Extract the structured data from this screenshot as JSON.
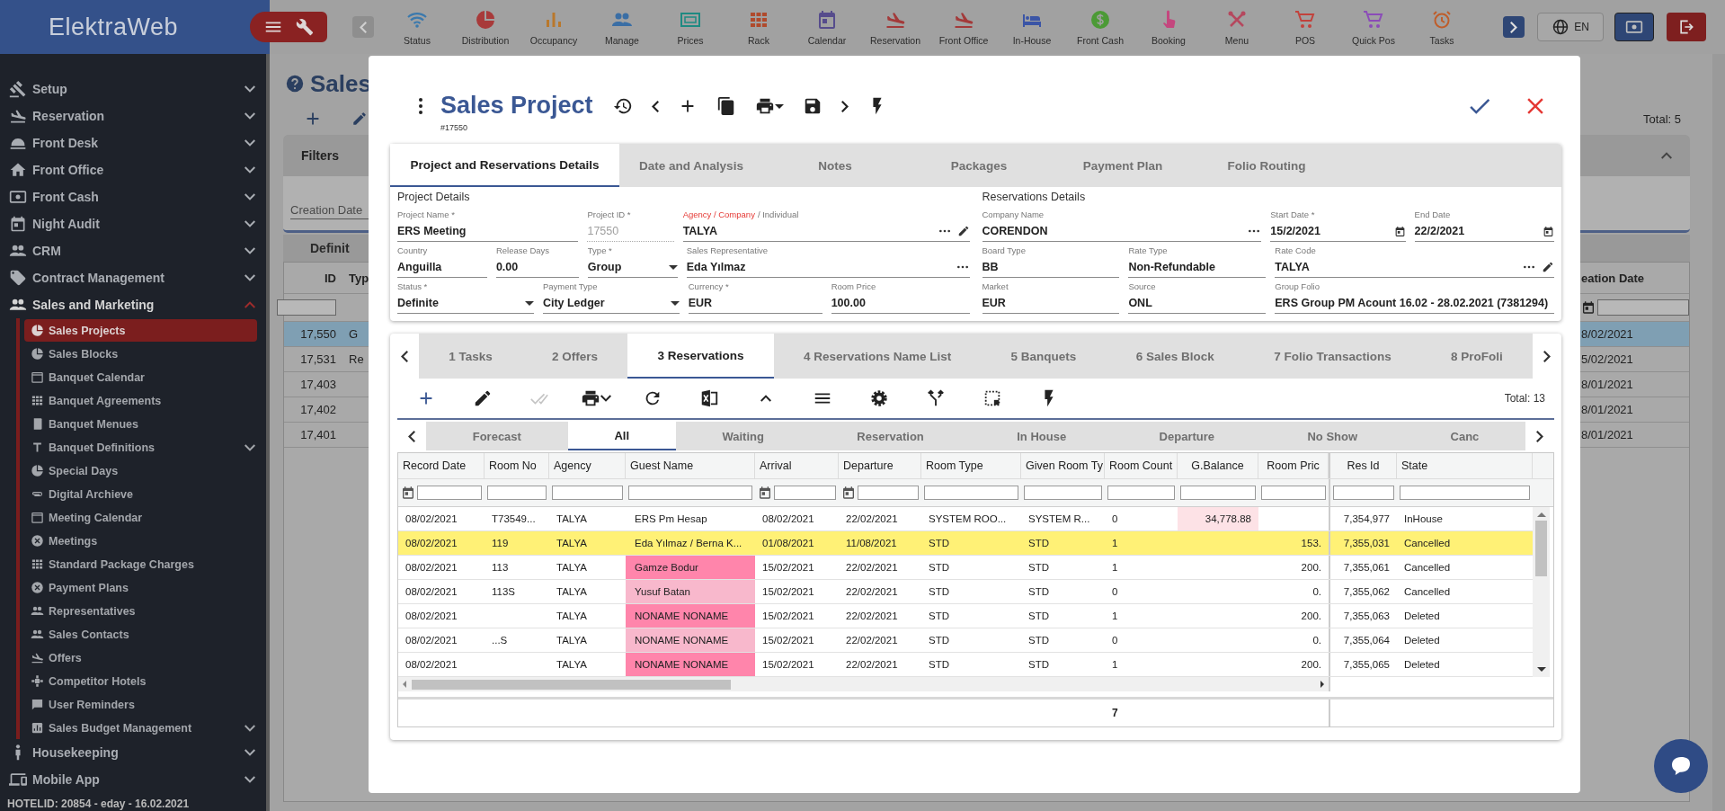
{
  "app": {
    "logo": "ElektraWeb"
  },
  "nav": {
    "items": [
      {
        "label": "Status",
        "color": "#3b79ad"
      },
      {
        "label": "Distribution",
        "color": "#a83a3a"
      },
      {
        "label": "Occupancy",
        "color": "#b9782c"
      },
      {
        "label": "Manage",
        "color": "#3a6ea5"
      },
      {
        "label": "Prices",
        "color": "#1e8a82"
      },
      {
        "label": "Rack",
        "color": "#b04a2c"
      },
      {
        "label": "Calendar",
        "color": "#564c8c"
      },
      {
        "label": "Reservation",
        "color": "#a33a3a"
      },
      {
        "label": "Front Office",
        "color": "#a33a3a"
      },
      {
        "label": "In-House",
        "color": "#3b55a6"
      },
      {
        "label": "Front Cash",
        "color": "#4c9a36"
      },
      {
        "label": "Booking",
        "color": "#c4477e"
      },
      {
        "label": "Menu",
        "color": "#b5485e"
      },
      {
        "label": "POS",
        "color": "#c2423c"
      },
      {
        "label": "Quick Pos",
        "color": "#8b4cb8"
      },
      {
        "label": "Tasks",
        "color": "#bf5d2a"
      }
    ]
  },
  "language": {
    "label": "EN"
  },
  "sidebar": {
    "items": [
      {
        "label": "Setup",
        "expanded": false
      },
      {
        "label": "Reservation",
        "expanded": false
      },
      {
        "label": "Front Desk",
        "expanded": false
      },
      {
        "label": "Front Office",
        "expanded": false
      },
      {
        "label": "Front Cash",
        "expanded": false
      },
      {
        "label": "Night Audit",
        "expanded": false
      },
      {
        "label": "CRM",
        "expanded": false
      },
      {
        "label": "Contract Management",
        "expanded": false
      },
      {
        "label": "Sales and Marketing",
        "expanded": true,
        "children": [
          {
            "label": "Sales Projects",
            "selected": true
          },
          {
            "label": "Sales Blocks",
            "selected": false
          },
          {
            "label": "Banquet Calendar",
            "selected": false
          },
          {
            "label": "Banquet Agreements",
            "selected": false
          },
          {
            "label": "Banquet Menues",
            "selected": false
          },
          {
            "label": "Banquet Definitions",
            "selected": false,
            "expanded": false
          },
          {
            "label": "Special Days",
            "selected": false
          },
          {
            "label": "Digital Archieve",
            "selected": false
          },
          {
            "label": "Meeting Calendar",
            "selected": false
          },
          {
            "label": "Meetings",
            "selected": false
          },
          {
            "label": "Standard Package Charges",
            "selected": false
          },
          {
            "label": "Payment Plans",
            "selected": false
          },
          {
            "label": "Representatives",
            "selected": false
          },
          {
            "label": "Sales Contacts",
            "selected": false
          },
          {
            "label": "Offers",
            "selected": false
          },
          {
            "label": "Competitor Hotels",
            "selected": false
          },
          {
            "label": "User Reminders",
            "selected": false
          },
          {
            "label": "Sales Budget Management",
            "selected": false,
            "expanded": false
          }
        ]
      },
      {
        "label": "Housekeeping",
        "expanded": false
      },
      {
        "label": "Mobile App",
        "expanded": false
      }
    ],
    "footer": "HOTELID: 20854 - eday - 16.02.2021"
  },
  "page": {
    "title": "Sales",
    "total": "Total: 5",
    "filters": {
      "title": "Filters",
      "expanded": true,
      "placeholder": "Creation Date"
    },
    "tab": "Definit",
    "grid": {
      "columns": [
        "ID",
        "Typ",
        "eation Date"
      ],
      "rows": [
        {
          "id": "17,550",
          "type": "G",
          "created": "8/02/2021",
          "selected": true
        },
        {
          "id": "17,531",
          "type": "Re",
          "created": "5/02/2021",
          "selected": false
        },
        {
          "id": "17,403",
          "created": "8/01/2021",
          "selected": false
        },
        {
          "id": "17,402",
          "created": "8/01/2021",
          "selected": false
        },
        {
          "id": "17,401",
          "created": "8/01/2021",
          "selected": false
        }
      ]
    }
  },
  "dialog": {
    "title": "Sales Project",
    "subtitle": "#17550",
    "tabs": [
      {
        "label": "Project and Reservations Details",
        "selected": true
      },
      {
        "label": "Date and Analysis",
        "selected": false
      },
      {
        "label": "Notes",
        "selected": false
      },
      {
        "label": "Packages",
        "selected": false
      },
      {
        "label": "Payment Plan",
        "selected": false
      },
      {
        "label": "Folio Routing",
        "selected": false
      }
    ],
    "sections": [
      {
        "title": "Project Details",
        "fields": [
          {
            "label": "Project Name *",
            "value": "ERS Meeting",
            "kind": "text"
          },
          {
            "label": "Project ID *",
            "value": "17550",
            "kind": "disabled"
          },
          {
            "label_parts": [
              {
                "text": "Agency / Company",
                "selected": true
              },
              {
                "text": "/ Individual",
                "selected": false
              }
            ],
            "value": "TALYA",
            "kind": "lookup_edit"
          },
          {
            "label": "Country",
            "value": "Anguilla",
            "kind": "text"
          },
          {
            "label": "Release Days",
            "value": "0.00",
            "kind": "text"
          },
          {
            "label": "Type *",
            "value": "Group",
            "kind": "select"
          },
          {
            "label": "Sales Representative",
            "value": "Eda Yılmaz",
            "kind": "lookup"
          },
          {
            "label": "Status *",
            "value": "Definite",
            "kind": "select"
          },
          {
            "label": "Payment Type",
            "value": "City Ledger",
            "kind": "select"
          },
          {
            "label": "Currency *",
            "value": "EUR",
            "kind": "text"
          },
          {
            "label": "Room Price",
            "value": "100.00",
            "kind": "text"
          }
        ]
      },
      {
        "title": "Reservations Details",
        "fields": [
          {
            "label": "Company Name",
            "value": "CORENDON",
            "kind": "lookup"
          },
          {
            "label": "Start Date *",
            "value": "15/2/2021",
            "kind": "date"
          },
          {
            "label": "End Date",
            "value": "22/2/2021",
            "kind": "date"
          },
          {
            "label": "Board Type",
            "value": "BB",
            "kind": "text"
          },
          {
            "label": "Rate Type",
            "value": "Non-Refundable",
            "kind": "text"
          },
          {
            "label": "Rate Code",
            "value": "TALYA",
            "kind": "lookup_edit"
          },
          {
            "label": "Market",
            "value": "EUR",
            "kind": "text"
          },
          {
            "label": "Source",
            "value": "ONL",
            "kind": "text"
          },
          {
            "label": "Group Folio",
            "value": "ERS Group PM Acount 16.02 - 28.02.2021 (7381294)",
            "kind": "text"
          }
        ]
      }
    ],
    "detail_tabs": [
      {
        "label": "1 Tasks",
        "selected": false
      },
      {
        "label": "2 Offers",
        "selected": false
      },
      {
        "label": "3 Reservations",
        "selected": true
      },
      {
        "label": "4 Reservations Name List",
        "selected": false
      },
      {
        "label": "5 Banquets",
        "selected": false
      },
      {
        "label": "6 Sales Block",
        "selected": false
      },
      {
        "label": "7 Folio Transactions",
        "selected": false
      },
      {
        "label": "8 ProFoli",
        "selected": false
      }
    ],
    "toolbar": {
      "buttons": [
        {
          "disabled": false
        },
        {
          "disabled": false
        },
        {
          "disabled": true
        },
        {
          "disabled": false
        },
        {
          "disabled": false
        },
        {
          "disabled": false
        },
        {
          "disabled": false
        },
        {
          "disabled": false
        },
        {
          "disabled": false
        },
        {
          "disabled": false
        },
        {
          "disabled": false
        },
        {
          "disabled": false
        }
      ],
      "total": "Total: 13"
    },
    "filter_tabs": [
      {
        "label": "Forecast",
        "selected": false
      },
      {
        "label": "All",
        "selected": true
      },
      {
        "label": "Waiting",
        "selected": false
      },
      {
        "label": "Reservation",
        "selected": false
      },
      {
        "label": "In House",
        "selected": false
      },
      {
        "label": "Departure",
        "selected": false
      },
      {
        "label": "No Show",
        "selected": false
      },
      {
        "label": "Canc",
        "selected": false
      }
    ],
    "grid": {
      "columns": [
        {
          "label": "Record Date",
          "kind": "date"
        },
        {
          "label": "Room No",
          "kind": "text"
        },
        {
          "label": "Agency",
          "kind": "text"
        },
        {
          "label": "Guest Name",
          "kind": "text"
        },
        {
          "label": "Arrival",
          "kind": "date"
        },
        {
          "label": "Departure",
          "kind": "date"
        },
        {
          "label": "Room Type",
          "kind": "text"
        },
        {
          "label": "Given Room Ty",
          "kind": "text"
        },
        {
          "label": "Room Count",
          "kind": "text"
        },
        {
          "label": "G.Balance",
          "kind": "number"
        },
        {
          "label": "Room Pric",
          "kind": "number"
        },
        {
          "label": "Res Id",
          "kind": "number"
        },
        {
          "label": "State",
          "kind": "text"
        }
      ],
      "rows": [
        {
          "record_date": "08/02/2021",
          "room_no": "T73549...",
          "agency": "TALYA",
          "guest_name": "ERS Pm Hesap",
          "arrival": "08/02/2021",
          "departure": "22/02/2021",
          "room_type": "SYSTEM ROO...",
          "given_room_type": "SYSTEM R...",
          "room_count": "0",
          "g_balance": "34,778.88",
          "res_id": "7,354,977",
          "state": "InHouse",
          "highlighted": false,
          "balance_flagged": true
        },
        {
          "record_date": "08/02/2021",
          "room_no": "119",
          "agency": "TALYA",
          "guest_name": "Eda Yılmaz / Berna K...",
          "arrival": "01/08/2021",
          "departure": "11/08/2021",
          "room_type": "STD",
          "given_room_type": "STD",
          "room_count": "1",
          "room_price": "153.",
          "res_id": "7,355,031",
          "state": "Cancelled",
          "highlighted": true,
          "balance_flagged": false
        },
        {
          "record_date": "08/02/2021",
          "room_no": "113",
          "agency": "TALYA",
          "guest_name": "Gamze Bodur",
          "arrival": "15/02/2021",
          "departure": "22/02/2021",
          "room_type": "STD",
          "given_room_type": "STD",
          "room_count": "1",
          "room_price": "200.",
          "res_id": "7,355,061",
          "state": "Cancelled",
          "highlighted": false,
          "balance_flagged": false,
          "color": "#ff85ab"
        },
        {
          "record_date": "08/02/2021",
          "room_no": "113S",
          "agency": "TALYA",
          "guest_name": "Yusuf Batan",
          "arrival": "15/02/2021",
          "departure": "22/02/2021",
          "room_type": "STD",
          "given_room_type": "STD",
          "room_count": "0",
          "room_price": "0.",
          "res_id": "7,355,062",
          "state": "Cancelled",
          "highlighted": false,
          "balance_flagged": false,
          "color": "#f8b8cc"
        },
        {
          "record_date": "08/02/2021",
          "agency": "TALYA",
          "guest_name": "NONAME NONAME",
          "arrival": "15/02/2021",
          "departure": "22/02/2021",
          "room_type": "STD",
          "given_room_type": "STD",
          "room_count": "1",
          "room_price": "200.",
          "res_id": "7,355,063",
          "state": "Deleted",
          "highlighted": false,
          "balance_flagged": false,
          "color": "#ff85ab"
        },
        {
          "record_date": "08/02/2021",
          "room_no": "...S",
          "agency": "TALYA",
          "guest_name": "NONAME NONAME",
          "arrival": "15/02/2021",
          "departure": "22/02/2021",
          "room_type": "STD",
          "given_room_type": "STD",
          "room_count": "0",
          "room_price": "0.",
          "res_id": "7,355,064",
          "state": "Deleted",
          "highlighted": false,
          "balance_flagged": false,
          "color": "#f8b8cc"
        },
        {
          "record_date": "08/02/2021",
          "agency": "TALYA",
          "guest_name": "NONAME NONAME",
          "arrival": "15/02/2021",
          "departure": "22/02/2021",
          "room_type": "STD",
          "given_room_type": "STD",
          "room_count": "1",
          "room_price": "200.",
          "res_id": "7,355,065",
          "state": "Deleted",
          "highlighted": false,
          "balance_flagged": false,
          "color": "#ff85ab"
        }
      ],
      "footer": {
        "room_count": "7"
      }
    }
  }
}
